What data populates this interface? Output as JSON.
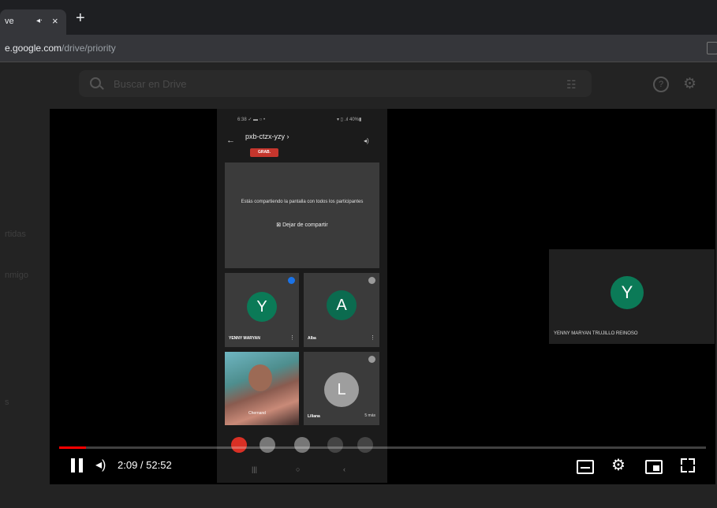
{
  "browser": {
    "tab_title": "ve",
    "tab_audio_icon": "speaker-icon",
    "tab_close": "×",
    "new_tab": "+",
    "url_host": "e.google.com",
    "url_path": "/drive/priority"
  },
  "drive": {
    "search_placeholder": "Buscar en Drive",
    "sidebar_partial_1": "rtidas",
    "sidebar_partial_2": "nmigo",
    "sidebar_partial_3": "s"
  },
  "meet": {
    "status_time": "6:38 ✓ ▬ ○ •",
    "status_right": "▾ ▯ .ıl 40%▮",
    "meeting_code": "pxb-ctzx-yzy ›",
    "rec_label": "GRAB.",
    "share_message": "Estás compartiendo la pantalla con todos los participantes",
    "stop_share": "⊠ Dejar de compartir",
    "participants": [
      {
        "initial": "Y",
        "name": "YENNY MARYAN",
        "color": "#0b7a57"
      },
      {
        "initial": "A",
        "name": "Alba",
        "color": "#0b6b4f"
      },
      {
        "initial": "L",
        "name": "Liliana",
        "color": "#9e9e9e",
        "extra": "5 más"
      }
    ],
    "photo_name": "Chernand",
    "right_initial": "Y",
    "right_name": "YENNY MARYAN TRUJILLO REINOSO"
  },
  "player": {
    "time": "2:09 / 52:52",
    "progress": 0.041,
    "colors": {
      "progress": "#ff0000"
    }
  }
}
